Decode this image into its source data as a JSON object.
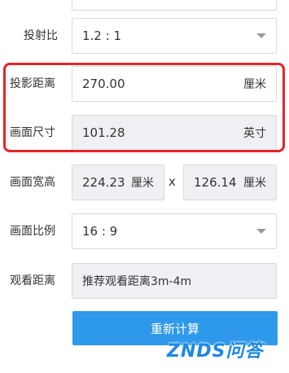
{
  "form": {
    "throw_ratio": {
      "label": "投射比",
      "value": "1.2 : 1"
    },
    "projection_distance": {
      "label": "投影距离",
      "value": "270.00",
      "unit": "厘米"
    },
    "screen_size": {
      "label": "画面尺寸",
      "value": "101.28",
      "unit": "英寸"
    },
    "screen_dimensions": {
      "label": "画面宽高",
      "width": "224.23",
      "width_unit": "厘米",
      "separator": "x",
      "height": "126.14",
      "height_unit": "厘米"
    },
    "aspect_ratio": {
      "label": "画面比例",
      "value": "16 : 9"
    },
    "viewing_distance": {
      "label": "观看距离",
      "value": "推荐观看距离3m-4m"
    }
  },
  "actions": {
    "recalculate_label": "重新计算"
  },
  "watermark": {
    "text": "ZNDS问答"
  },
  "colors": {
    "accent": "#2e98ea",
    "highlight": "#e8232a",
    "readonly_bg": "#eef0f3"
  }
}
